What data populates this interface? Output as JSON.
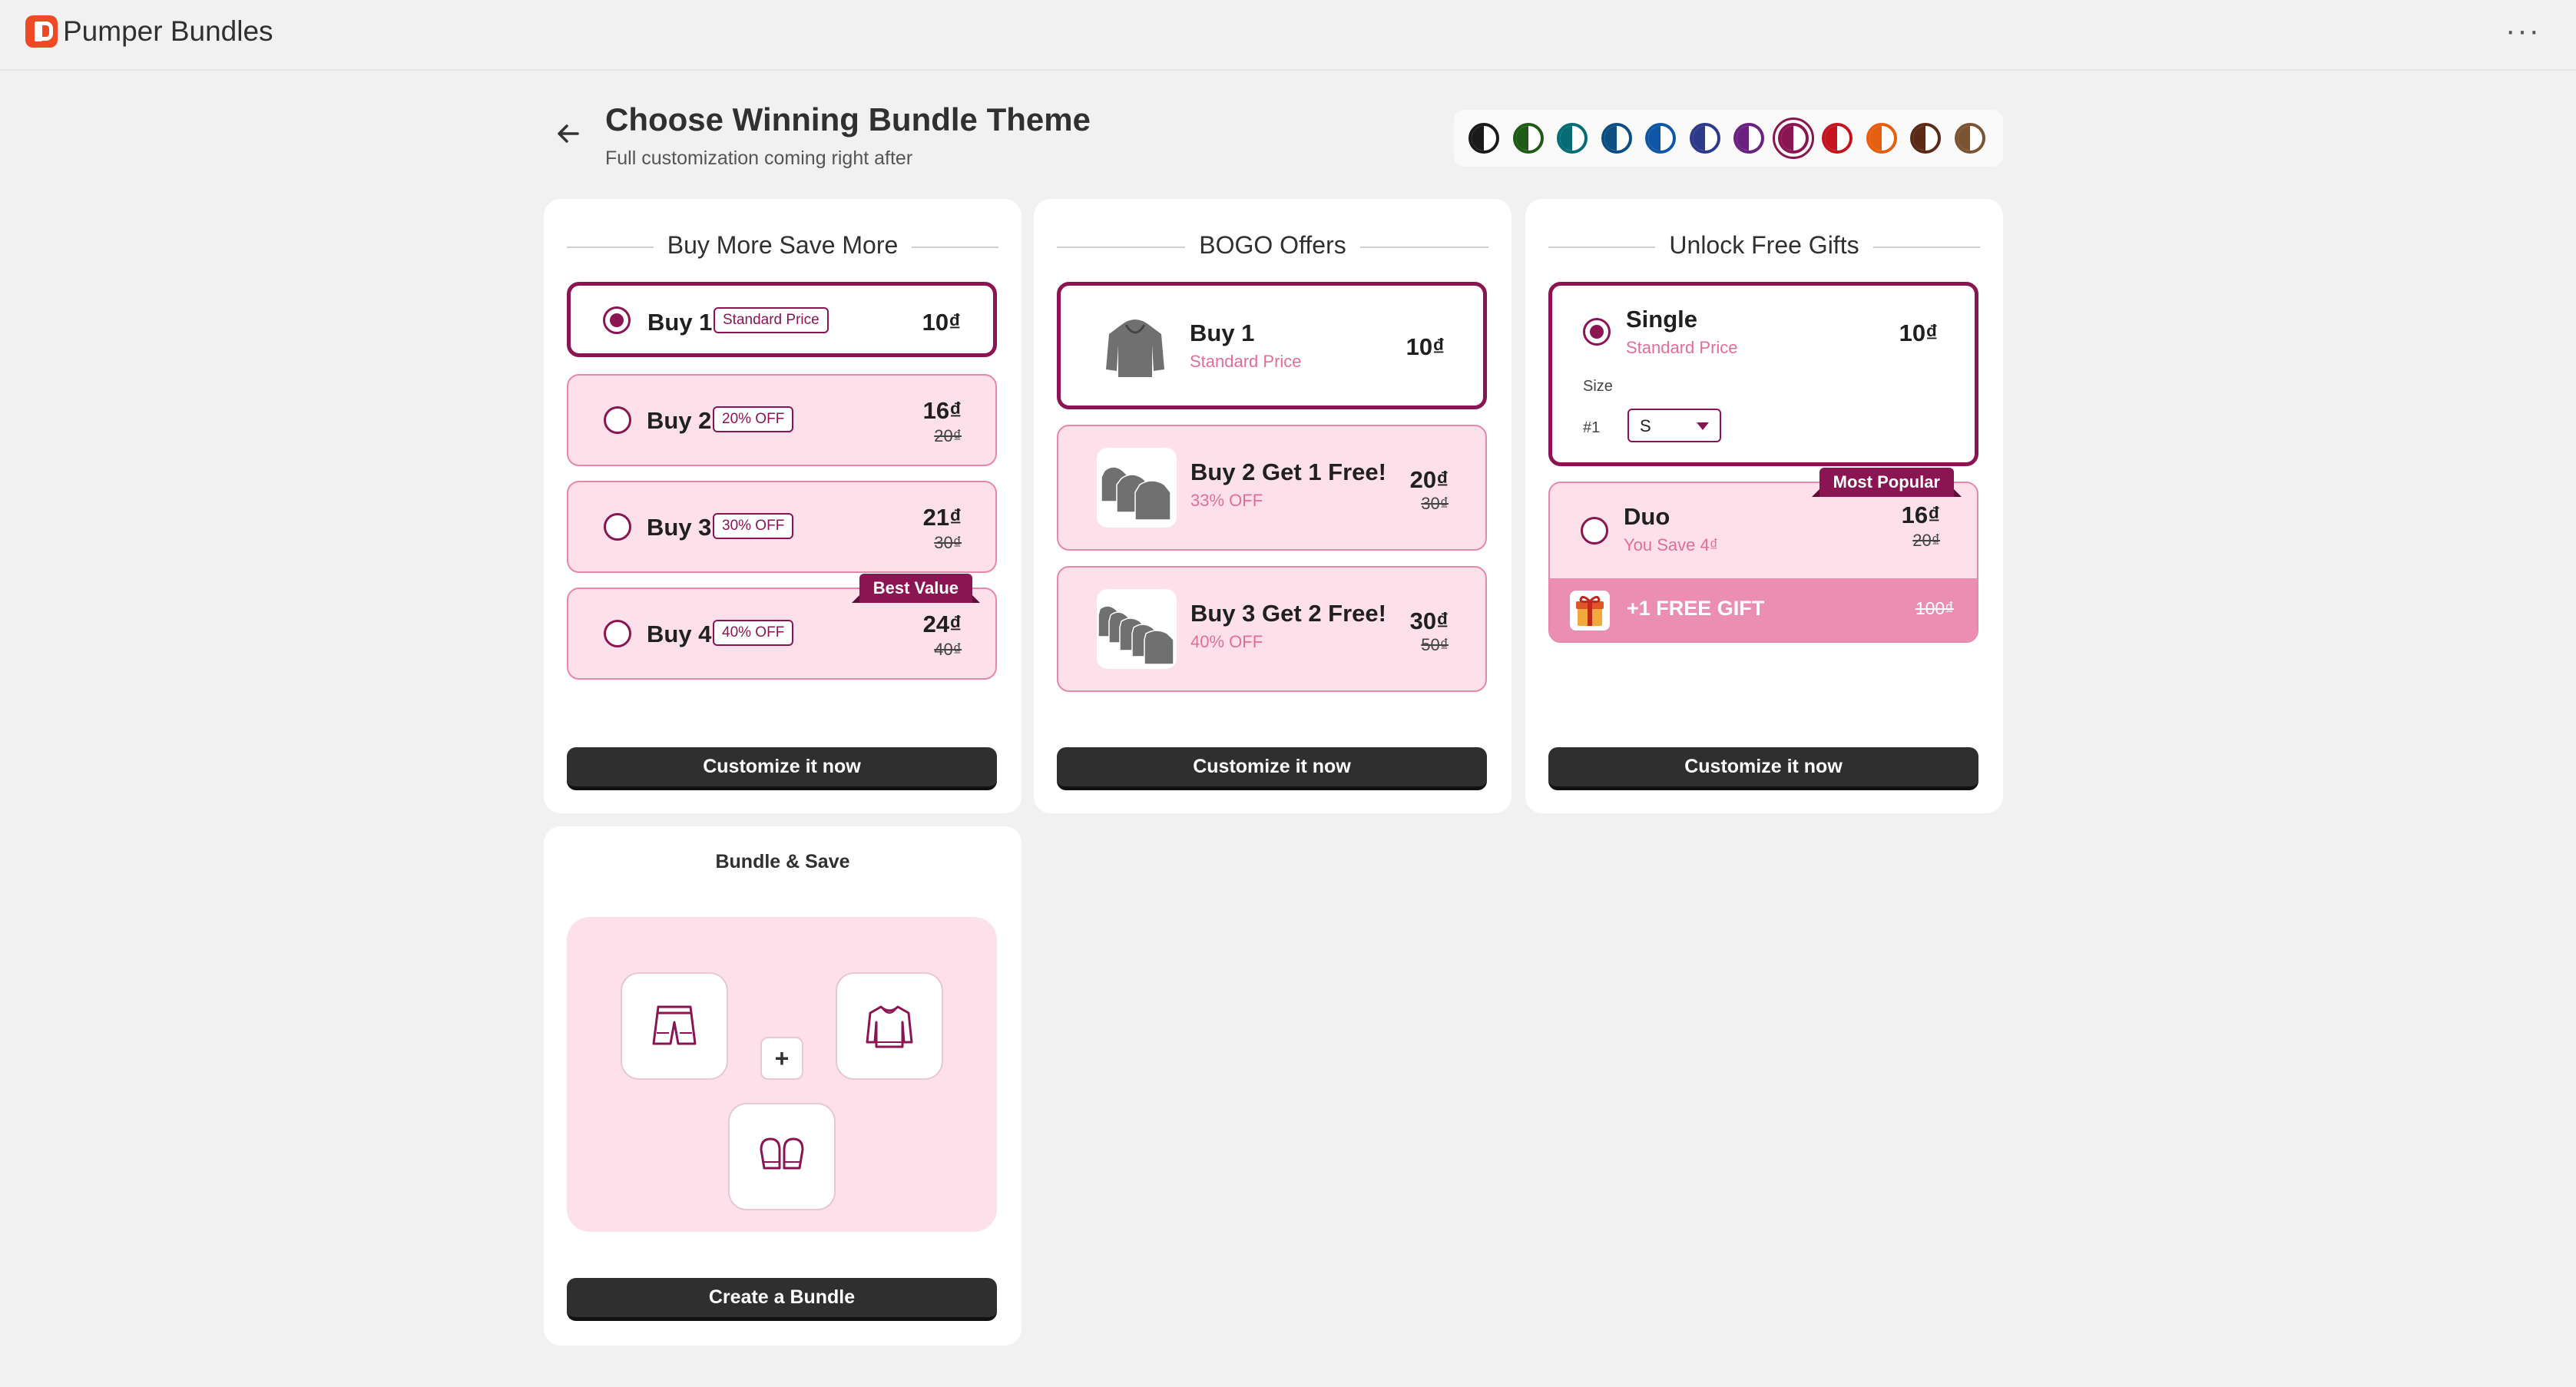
{
  "app": {
    "name": "Pumper Bundles"
  },
  "header": {
    "title": "Choose Winning Bundle Theme",
    "subtitle": "Full customization coming right after"
  },
  "themes": [
    {
      "color": "#1a1a1a"
    },
    {
      "color": "#1f5a17"
    },
    {
      "color": "#046c74"
    },
    {
      "color": "#0b4f82"
    },
    {
      "color": "#0f57a6"
    },
    {
      "color": "#2d3a8c"
    },
    {
      "color": "#6b2180"
    },
    {
      "color": "#8a1552",
      "selected": true
    },
    {
      "color": "#c4141d"
    },
    {
      "color": "#e65e0f"
    },
    {
      "color": "#5b2a16"
    },
    {
      "color": "#7a5432"
    }
  ],
  "colors": {
    "accent": "#8a1552",
    "light": "#fde0ea",
    "cta": "#2f2f2f"
  },
  "cards": {
    "volume": {
      "heading": "Buy More Save More",
      "options": [
        {
          "title": "Buy 1",
          "badge": "Standard Price",
          "price": "10₫",
          "compare": ""
        },
        {
          "title": "Buy 2",
          "badge": "20% OFF",
          "price": "16₫",
          "compare": "20₫"
        },
        {
          "title": "Buy 3",
          "badge": "30% OFF",
          "price": "21₫",
          "compare": "30₫"
        },
        {
          "title": "Buy 4",
          "badge": "40% OFF",
          "price": "24₫",
          "compare": "40₫",
          "ribbon": "Best Value"
        }
      ],
      "cta": "Customize it now"
    },
    "bogo": {
      "heading": "BOGO Offers",
      "options": [
        {
          "title": "Buy 1",
          "sub": "Standard Price",
          "price": "10₫",
          "compare": ""
        },
        {
          "title": "Buy 2 Get 1 Free!",
          "sub": "33% OFF",
          "price": "20₫",
          "compare": "30₫"
        },
        {
          "title": "Buy 3 Get 2 Free!",
          "sub": "40% OFF",
          "price": "30₫",
          "compare": "50₫"
        }
      ],
      "cta": "Customize it now"
    },
    "gifts": {
      "heading": "Unlock Free Gifts",
      "single": {
        "title": "Single",
        "sub": "Standard Price",
        "price": "10₫",
        "size_label": "Size",
        "item_label": "#1",
        "size_value": "S"
      },
      "duo": {
        "title": "Duo",
        "sub": "You Save 4₫",
        "price": "16₫",
        "compare": "20₫",
        "ribbon": "Most Popular",
        "gift_text": "+1 FREE GIFT",
        "gift_compare": "100₫"
      },
      "cta": "Customize it now"
    },
    "bundle": {
      "heading": "Bundle & Save",
      "plus": "+",
      "items": [
        {
          "icon": "shorts-icon"
        },
        {
          "icon": "sweater-icon"
        },
        {
          "icon": "mittens-icon"
        }
      ],
      "cta": "Create a Bundle"
    }
  }
}
